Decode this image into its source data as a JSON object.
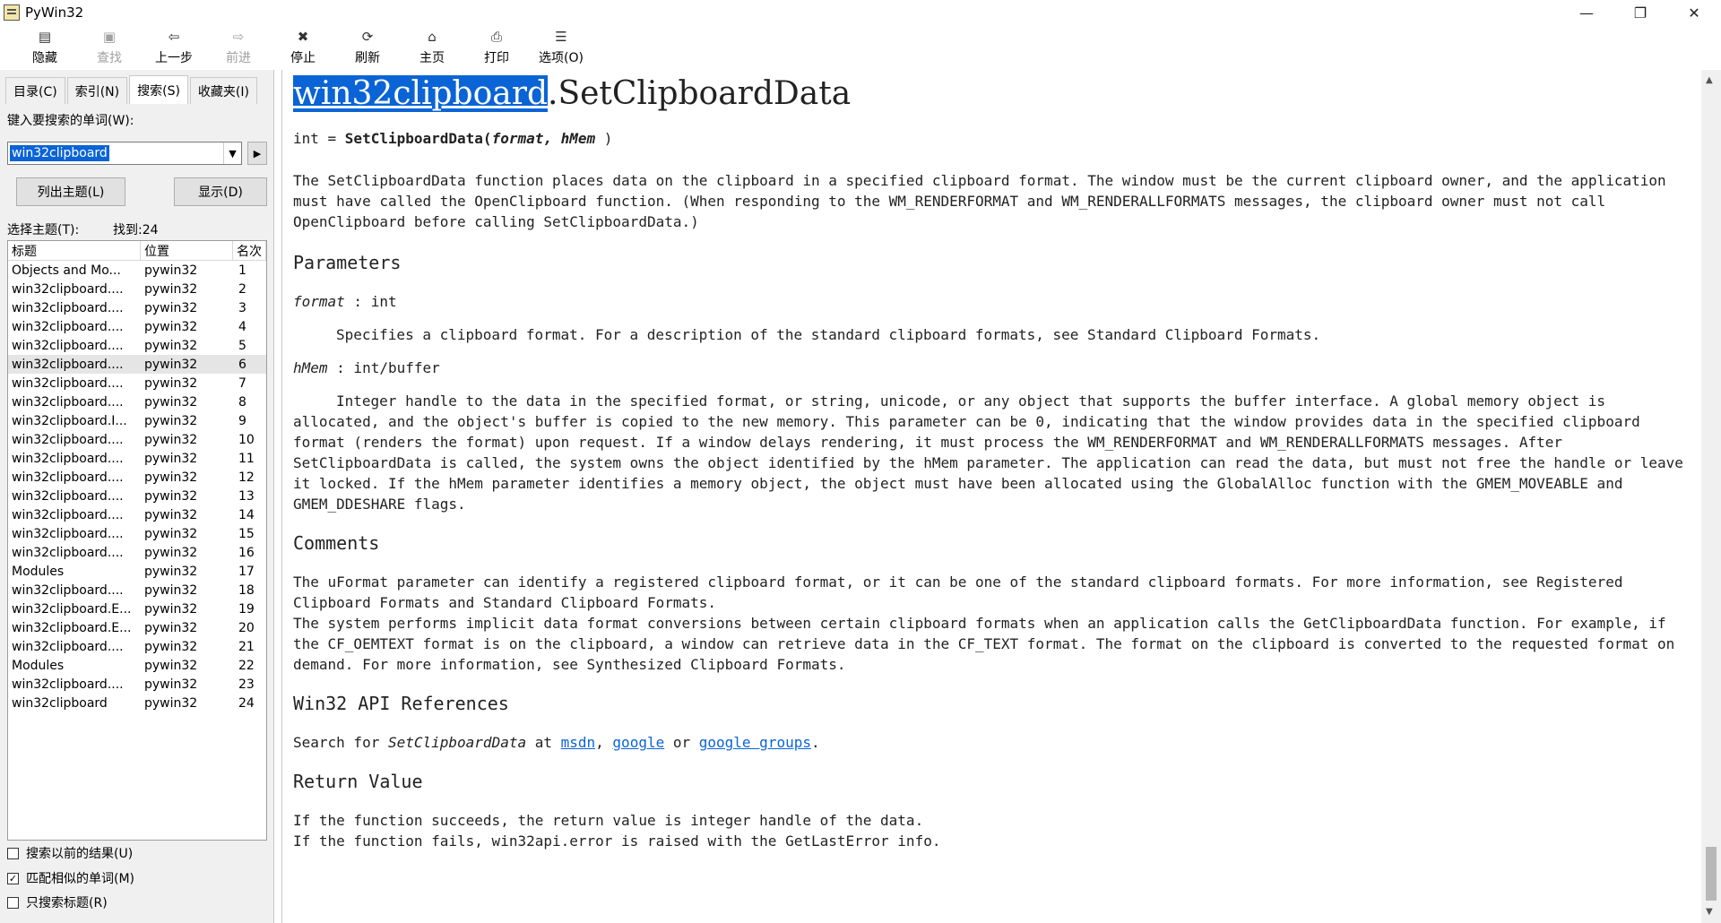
{
  "window": {
    "title": "PyWin32",
    "controls": [
      "—",
      "❐",
      "✕"
    ]
  },
  "toolbar": {
    "buttons": [
      {
        "label": "隐藏",
        "icon": "hide-icon",
        "enabled": true
      },
      {
        "label": "查找",
        "icon": "find-icon",
        "enabled": false
      },
      {
        "label": "上一步",
        "icon": "back-icon",
        "enabled": true
      },
      {
        "label": "前进",
        "icon": "forward-icon",
        "enabled": false
      },
      {
        "label": "停止",
        "icon": "stop-icon",
        "enabled": true
      },
      {
        "label": "刷新",
        "icon": "refresh-icon",
        "enabled": true
      },
      {
        "label": "主页",
        "icon": "home-icon",
        "enabled": true
      },
      {
        "label": "打印",
        "icon": "print-icon",
        "enabled": true
      },
      {
        "label": "选项(O)",
        "icon": "options-icon",
        "enabled": true
      }
    ]
  },
  "sidebar": {
    "tabs": [
      "目录(C)",
      "索引(N)",
      "搜索(S)",
      "收藏夹(I)"
    ],
    "active_tab": "搜索(S)",
    "search_label": "键入要搜索的单词(W):",
    "search_value": "win32clipboard",
    "list_topics_button": "列出主题(L)",
    "display_button": "显示(D)",
    "select_topic_label": "选择主题(T):",
    "found_label": "找到:24",
    "columns": [
      "标题",
      "位置",
      "名次"
    ],
    "rows": [
      {
        "title": "Objects and Mo...",
        "location": "pywin32",
        "rank": "1"
      },
      {
        "title": "win32clipboard....",
        "location": "pywin32",
        "rank": "2"
      },
      {
        "title": "win32clipboard....",
        "location": "pywin32",
        "rank": "3"
      },
      {
        "title": "win32clipboard....",
        "location": "pywin32",
        "rank": "4"
      },
      {
        "title": "win32clipboard....",
        "location": "pywin32",
        "rank": "5"
      },
      {
        "title": "win32clipboard....",
        "location": "pywin32",
        "rank": "6"
      },
      {
        "title": "win32clipboard....",
        "location": "pywin32",
        "rank": "7"
      },
      {
        "title": "win32clipboard....",
        "location": "pywin32",
        "rank": "8"
      },
      {
        "title": "win32clipboard.I...",
        "location": "pywin32",
        "rank": "9"
      },
      {
        "title": "win32clipboard....",
        "location": "pywin32",
        "rank": "10"
      },
      {
        "title": "win32clipboard....",
        "location": "pywin32",
        "rank": "11"
      },
      {
        "title": "win32clipboard....",
        "location": "pywin32",
        "rank": "12"
      },
      {
        "title": "win32clipboard....",
        "location": "pywin32",
        "rank": "13"
      },
      {
        "title": "win32clipboard....",
        "location": "pywin32",
        "rank": "14"
      },
      {
        "title": "win32clipboard....",
        "location": "pywin32",
        "rank": "15"
      },
      {
        "title": "win32clipboard....",
        "location": "pywin32",
        "rank": "16"
      },
      {
        "title": "Modules",
        "location": "pywin32",
        "rank": "17"
      },
      {
        "title": "win32clipboard....",
        "location": "pywin32",
        "rank": "18"
      },
      {
        "title": "win32clipboard.E...",
        "location": "pywin32",
        "rank": "19"
      },
      {
        "title": "win32clipboard.E...",
        "location": "pywin32",
        "rank": "20"
      },
      {
        "title": "win32clipboard....",
        "location": "pywin32",
        "rank": "21"
      },
      {
        "title": "Modules",
        "location": "pywin32",
        "rank": "22"
      },
      {
        "title": "win32clipboard....",
        "location": "pywin32",
        "rank": "23"
      },
      {
        "title": "win32clipboard",
        "location": "pywin32",
        "rank": "24"
      }
    ],
    "selected_row_index": 5,
    "checkboxes": [
      {
        "label": "搜索以前的结果(U)",
        "checked": false
      },
      {
        "label": "匹配相似的单词(M)",
        "checked": true
      },
      {
        "label": "只搜索标题(R)",
        "checked": false
      }
    ]
  },
  "doc": {
    "title_highlight": "win32clipboard",
    "title_rest": ".SetClipboardData",
    "signature_prefix": "int = ",
    "signature_func": "SetClipboardData(",
    "signature_args": "format, hMem",
    "signature_close": " )",
    "intro": "The SetClipboardData function places data on the clipboard in a specified clipboard format. The window must be the current clipboard owner, and the application must have called the OpenClipboard function. (When responding to the WM_RENDERFORMAT and WM_RENDERALLFORMATS messages, the clipboard owner must not call OpenClipboard before calling SetClipboardData.)",
    "parameters_heading": "Parameters",
    "param1_name": "format",
    "param1_type": " : int",
    "param1_desc": "Specifies a clipboard format. For a description of the standard clipboard formats, see Standard Clipboard Formats.",
    "param2_name": "hMem",
    "param2_type": " : int/buffer",
    "param2_desc": "Integer handle to the data in the specified format, or string, unicode, or any object that supports the buffer interface. A global memory object is allocated, and the object's buffer is copied to the new memory. This parameter can be 0, indicating that the window provides data in the specified clipboard format (renders the format) upon request. If a window delays rendering, it must process the WM_RENDERFORMAT and WM_RENDERALLFORMATS messages. After SetClipboardData is called, the system owns the object identified by the hMem parameter. The application can read the data, but must not free the handle or leave it locked. If the hMem parameter identifies a memory object, the object must have been allocated using the GlobalAlloc function with the GMEM_MOVEABLE and GMEM_DDESHARE flags.",
    "comments_heading": "Comments",
    "comments_p1": "The uFormat parameter can identify a registered clipboard format, or it can be one of the standard clipboard formats. For more information, see Registered Clipboard Formats and Standard Clipboard Formats.",
    "comments_p2": "The system performs implicit data format conversions between certain clipboard formats when an application calls the GetClipboardData function. For example, if the CF_OEMTEXT format is on the clipboard, a window can retrieve data in the CF_TEXT format. The format on the clipboard is converted to the requested format on demand. For more information, see Synthesized Clipboard Formats.",
    "refs_heading": "Win32 API References",
    "refs_search": "Search for ",
    "refs_term": "SetClipboardData",
    "refs_at": " at ",
    "link_msdn": "msdn",
    "refs_comma": ", ",
    "link_google": "google",
    "refs_or": " or ",
    "link_groups": "google groups",
    "refs_period": ".",
    "return_heading": "Return Value",
    "return_p1": "If the function succeeds, the return value is integer handle of the data.",
    "return_p2": "If the function fails, win32api.error is raised with the GetLastError info."
  }
}
